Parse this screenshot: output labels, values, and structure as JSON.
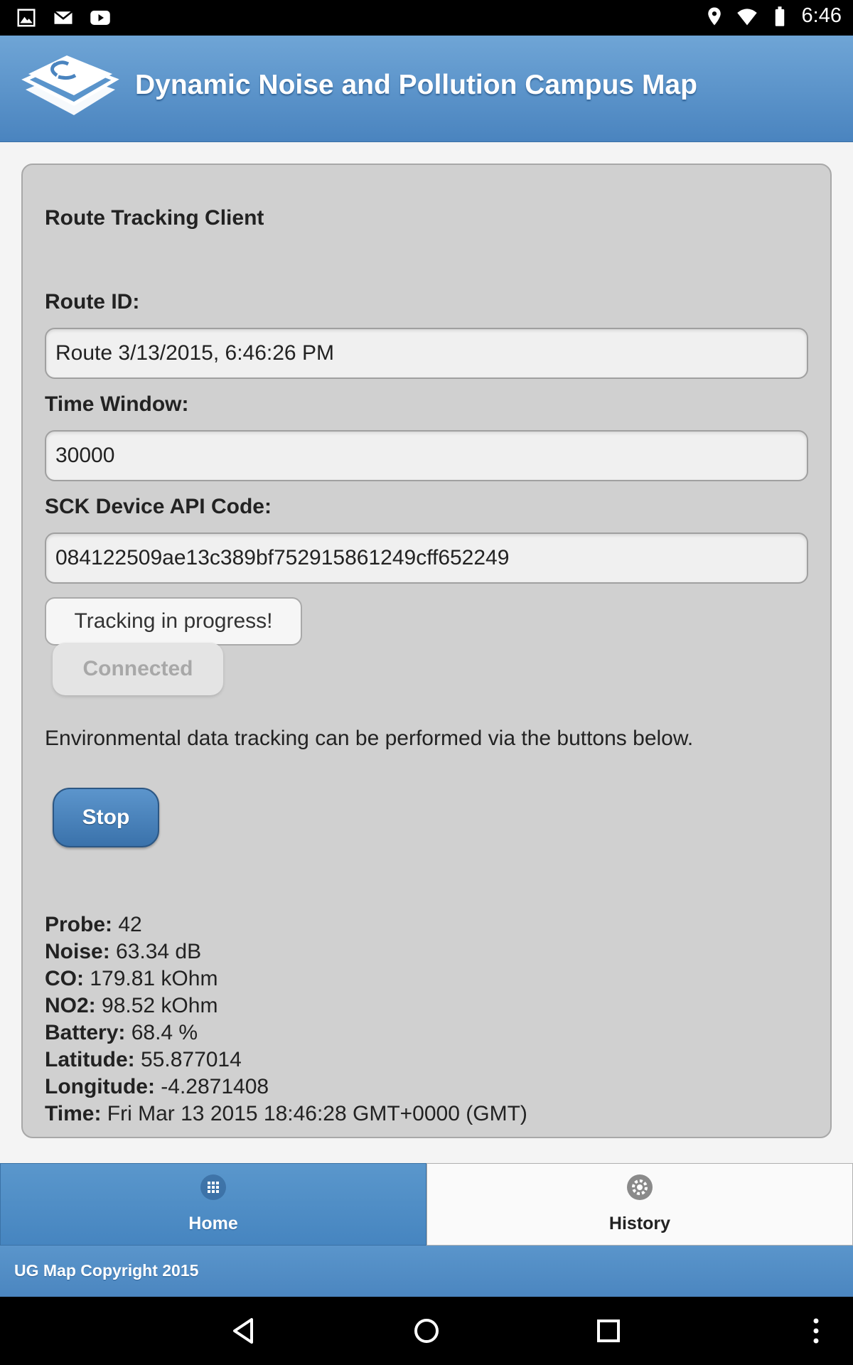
{
  "status_bar": {
    "time": "6:46",
    "left_icons": [
      "image-icon",
      "mail-icon",
      "youtube-icon"
    ],
    "right_icons": [
      "location-icon",
      "wifi-icon",
      "battery-icon"
    ]
  },
  "header": {
    "title": "Dynamic Noise and Pollution Campus Map",
    "logo": "campus-map-logo"
  },
  "card": {
    "title": "Route Tracking Client",
    "fields": {
      "route_id_label": "Route ID:",
      "route_id_value": "Route 3/13/2015, 6:46:26 PM",
      "time_window_label": "Time Window:",
      "time_window_value": "30000",
      "api_code_label": "SCK Device API Code:",
      "api_code_value": "084122509ae13c389bf752915861249cff652249"
    },
    "tracking_button": "Tracking in progress!",
    "connected_button": "Connected",
    "info_text": "Environmental data tracking can be performed via the buttons below.",
    "stop_button": "Stop",
    "readings": [
      {
        "label": "Probe:",
        "value": " 42"
      },
      {
        "label": "Noise:",
        "value": " 63.34 dB"
      },
      {
        "label": "CO:",
        "value": " 179.81 kOhm"
      },
      {
        "label": "NO2:",
        "value": " 98.52 kOhm"
      },
      {
        "label": "Battery:",
        "value": " 68.4 %"
      },
      {
        "label": "Latitude:",
        "value": " 55.877014"
      },
      {
        "label": "Longitude:",
        "value": " -4.2871408"
      },
      {
        "label": "Time:",
        "value": " Fri Mar 13 2015 18:46:28 GMT+0000 (GMT)"
      }
    ]
  },
  "tabs": [
    {
      "label": "Home",
      "icon": "grid-icon",
      "active": true
    },
    {
      "label": "History",
      "icon": "gear-icon",
      "active": false
    }
  ],
  "footer": {
    "text": "UG Map Copyright 2015"
  },
  "colors": {
    "header": "#4a84bf",
    "accent": "#3a72ab",
    "card_bg": "#d0d0d0"
  }
}
